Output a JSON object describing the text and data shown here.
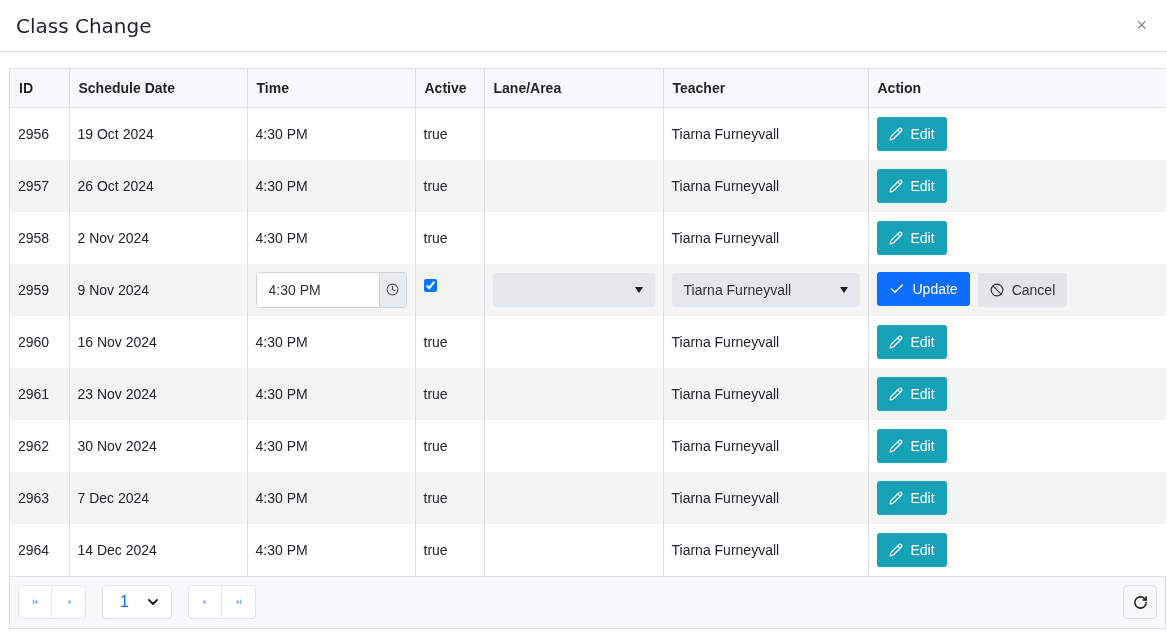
{
  "window": {
    "title": "Class Change",
    "close": "×"
  },
  "table": {
    "columns": [
      "ID",
      "Schedule Date",
      "Time",
      "Active",
      "Lane/Area",
      "Teacher",
      "Action"
    ],
    "rows": [
      {
        "kind": "view",
        "id": "2956",
        "date": "19 Oct 2024",
        "time": "4:30 PM",
        "active": "true",
        "teacher": "Tiarna Furneyvall",
        "button": "Edit"
      },
      {
        "kind": "view",
        "id": "2957",
        "date": "26 Oct 2024",
        "time": "4:30 PM",
        "active": "true",
        "teacher": "Tiarna Furneyvall",
        "button": "Edit"
      },
      {
        "kind": "view",
        "id": "2958",
        "date": "2 Nov 2024",
        "time": "4:30 PM",
        "active": "true",
        "teacher": "Tiarna Furneyvall",
        "button": "Edit"
      },
      {
        "kind": "edit",
        "id": "2959",
        "date": "9 Nov 2024",
        "time": "4:30 PM",
        "checked": true,
        "teacher": "Tiarna Furneyvall",
        "update": "Update",
        "cancel": "Cancel"
      },
      {
        "kind": "view",
        "id": "2960",
        "date": "16 Nov 2024",
        "time": "4:30 PM",
        "active": "true",
        "teacher": "Tiarna Furneyvall",
        "button": "Edit"
      },
      {
        "kind": "view",
        "id": "2961",
        "date": "23 Nov 2024",
        "time": "4:30 PM",
        "active": "true",
        "teacher": "Tiarna Furneyvall",
        "button": "Edit"
      },
      {
        "kind": "view",
        "id": "2962",
        "date": "30 Nov 2024",
        "time": "4:30 PM",
        "active": "true",
        "teacher": "Tiarna Furneyvall",
        "button": "Edit"
      },
      {
        "kind": "view",
        "id": "2963",
        "date": "7 Dec 2024",
        "time": "4:30 PM",
        "active": "true",
        "teacher": "Tiarna Furneyvall",
        "button": "Edit"
      },
      {
        "kind": "view",
        "id": "2964",
        "date": "14 Dec 2024",
        "time": "4:30 PM",
        "active": "true",
        "teacher": "Tiarna Furneyvall",
        "button": "Edit"
      }
    ]
  },
  "pager": {
    "page": "1"
  }
}
